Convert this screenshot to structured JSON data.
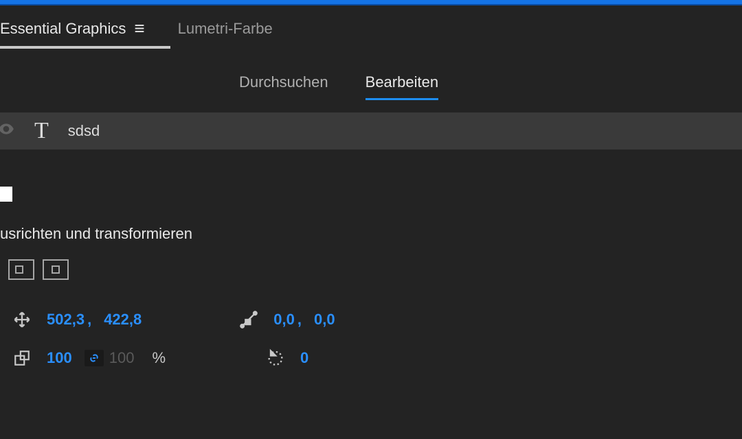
{
  "panelTabs": {
    "essentialGraphics": "Essential Graphics",
    "lumetriFarbe": "Lumetri-Farbe"
  },
  "subTabs": {
    "browse": "Durchsuchen",
    "edit": "Bearbeiten"
  },
  "layer": {
    "name": "sdsd",
    "typeIcon": "T"
  },
  "sections": {
    "alignTransform": "usrichten und transformieren"
  },
  "transform": {
    "position": {
      "x": "502,3",
      "sep": " ,",
      "y": "422,8"
    },
    "anchor": {
      "x": "0,0",
      "sep": " ,",
      "y": "0,0"
    },
    "scale": {
      "x": "100",
      "y": "100",
      "unit": "%"
    },
    "rotation": "0"
  }
}
